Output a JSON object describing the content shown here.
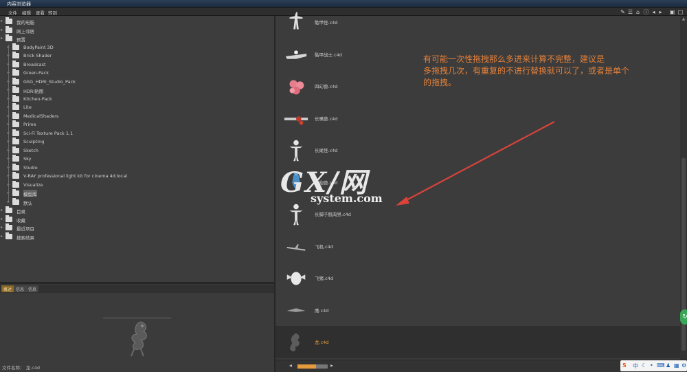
{
  "window": {
    "title": "内容浏览器"
  },
  "menu": [
    "文件",
    "编辑",
    "查看",
    "转到"
  ],
  "tree": [
    {
      "label": "我的电脑",
      "icon": "computer-icon",
      "indent": 0
    },
    {
      "label": "网上邻居",
      "icon": "network-icon",
      "indent": 0
    },
    {
      "label": "预置",
      "icon": "folder-icon",
      "indent": 0
    },
    {
      "label": "BodyPaint 3D",
      "icon": "folder-icon",
      "indent": 1
    },
    {
      "label": "Brick Shader",
      "icon": "folder-icon",
      "indent": 1
    },
    {
      "label": "Broadcast",
      "icon": "folder-icon",
      "indent": 1
    },
    {
      "label": "Green-Pack",
      "icon": "folder-icon",
      "indent": 1
    },
    {
      "label": "GSG_HDRI_Studio_Pack",
      "icon": "folder-icon",
      "indent": 1
    },
    {
      "label": "HDRI贴图",
      "icon": "folder-icon",
      "indent": 1
    },
    {
      "label": "Kitchen-Pack",
      "icon": "folder-icon",
      "indent": 1
    },
    {
      "label": "Lite",
      "icon": "folder-icon",
      "indent": 1
    },
    {
      "label": "MedicalShaders",
      "icon": "folder-icon",
      "indent": 1
    },
    {
      "label": "Prime",
      "icon": "folder-icon",
      "indent": 1
    },
    {
      "label": "Sci-Fi Texture Pack 1.1",
      "icon": "folder-icon",
      "indent": 1
    },
    {
      "label": "Sculpting",
      "icon": "folder-icon",
      "indent": 1
    },
    {
      "label": "Sketch",
      "icon": "folder-icon",
      "indent": 1
    },
    {
      "label": "Sky",
      "icon": "folder-icon",
      "indent": 1
    },
    {
      "label": "Studio",
      "icon": "folder-icon",
      "indent": 1
    },
    {
      "label": "V-RAY professional light kit for cinema 4d.local",
      "icon": "folder-icon",
      "indent": 1
    },
    {
      "label": "Visualize",
      "icon": "folder-icon",
      "indent": 1
    },
    {
      "label": "模型库",
      "icon": "folder-icon",
      "indent": 1,
      "selected": true
    },
    {
      "label": "默认",
      "icon": "folder-icon",
      "indent": 1
    },
    {
      "label": "目录",
      "icon": "catalog-icon",
      "indent": 0
    },
    {
      "label": "收藏",
      "icon": "star-icon",
      "indent": 0
    },
    {
      "label": "最近项目",
      "icon": "folder-icon",
      "indent": 0
    },
    {
      "label": "搜索结果",
      "icon": "search-icon",
      "indent": 0
    }
  ],
  "tabs": [
    "概述",
    "信息",
    "信息"
  ],
  "preview": {
    "file_label": "文件名称：",
    "file_name": "龙.c4d"
  },
  "files": [
    {
      "name": "骷甲怪.c4d",
      "thumb": "skeleton"
    },
    {
      "name": "骷甲战士.c4d",
      "thumb": "warrior"
    },
    {
      "name": "四幻兽.c4d",
      "thumb": "pink-blob"
    },
    {
      "name": "长嘴兽.c4d",
      "thumb": "redbeast"
    },
    {
      "name": "长尾怪.c4d",
      "thumb": "figure"
    },
    {
      "name": "长翅兽.c4d",
      "thumb": "blue"
    },
    {
      "name": "长脚子肌肉男.c4d",
      "thumb": "figure"
    },
    {
      "name": "飞机.c4d",
      "thumb": "plane"
    },
    {
      "name": "飞猪.c4d",
      "thumb": "pig"
    },
    {
      "name": "鹰.c4d",
      "thumb": "bird"
    },
    {
      "name": "龙.c4d",
      "thumb": "dragon",
      "selected": true
    }
  ],
  "annotation": {
    "line1": "有可能一次性拖拽那么多进来计算不完整，建议是",
    "line2": "多拖拽几次，有重复的不进行替换就可以了，或者是单个",
    "line3": "的拖拽。"
  },
  "watermark": {
    "big": "GX/网",
    "small": "system.com"
  },
  "zoom": {
    "fraction": 0.62
  },
  "colors": {
    "accent": "#e59a3b",
    "annotation": "#e3803a",
    "arrow": "#d9433a"
  }
}
